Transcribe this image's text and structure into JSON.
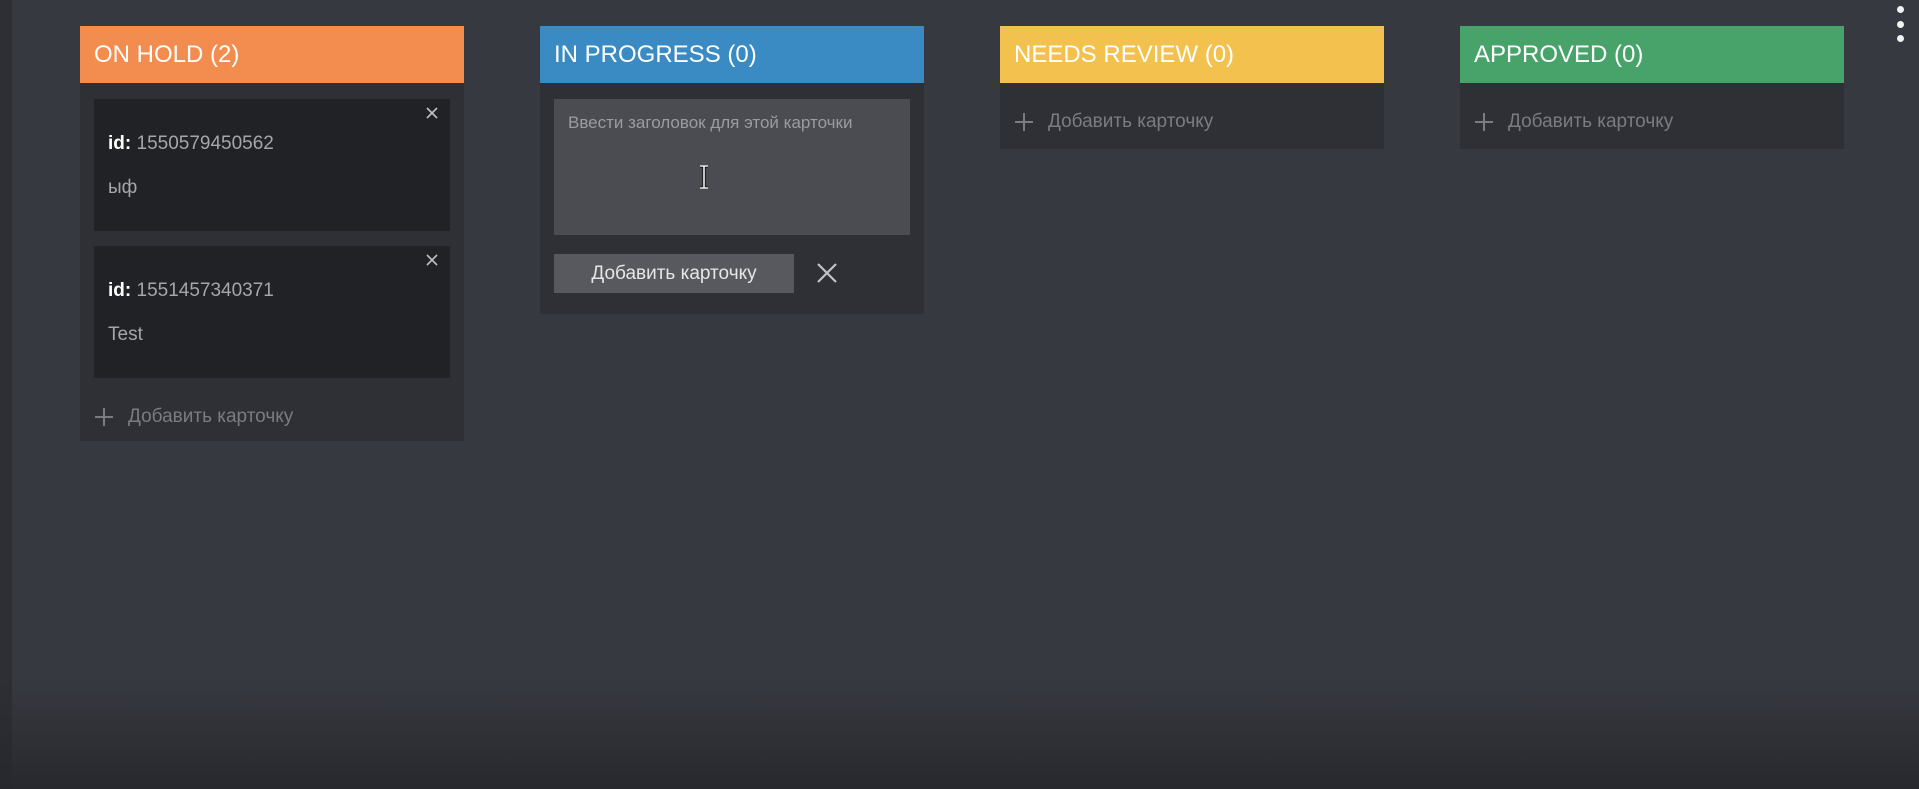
{
  "board": {
    "columns": [
      {
        "title": "ON HOLD (2)",
        "color": "#f28c4f",
        "cards": [
          {
            "id_label": "id:",
            "id_value": "1550579450562",
            "title": "ыф"
          },
          {
            "id_label": "id:",
            "id_value": "1551457340371",
            "title": "Test"
          }
        ],
        "add_label": "Добавить карточку"
      },
      {
        "title": "IN PROGRESS (0)",
        "color": "#3a8bc3",
        "composer": {
          "placeholder": "Ввести заголовок для этой карточки",
          "submit_label": "Добавить карточку"
        }
      },
      {
        "title": "NEEDS REVIEW (0)",
        "color": "#f2c14e",
        "add_label": "Добавить карточку"
      },
      {
        "title": "APPROVED (0)",
        "color": "#47a36a",
        "add_label": "Добавить карточку"
      }
    ]
  },
  "icons": {
    "card_close": "close-icon",
    "add": "plus-icon",
    "cancel": "close-icon",
    "menu": "kebab-menu-icon",
    "cursor": "text-cursor-icon"
  }
}
